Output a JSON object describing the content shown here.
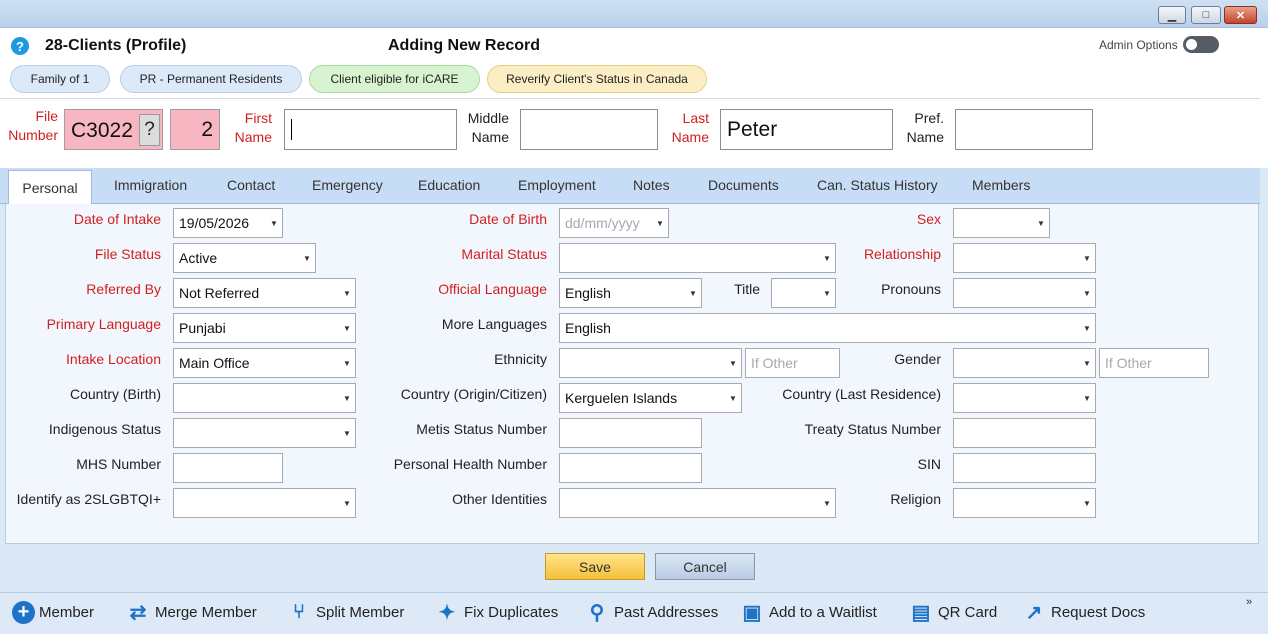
{
  "window": {
    "min_label": "▁",
    "max_label": "□",
    "close_label": "✕"
  },
  "header": {
    "title": "28-Clients (Profile)",
    "mode": "Adding New Record",
    "admin_options": "Admin Options",
    "help_glyph": "?"
  },
  "chips": [
    {
      "label": "Family of 1",
      "color": "#dce9f8"
    },
    {
      "label": "PR - Permanent Residents",
      "color": "#dce9f8"
    },
    {
      "label": "Client eligible for iCARE",
      "color": "#d8f3d0"
    },
    {
      "label": "Reverify Client's Status in Canada",
      "color": "#fbeec4"
    }
  ],
  "record": {
    "file_number_label1": "File",
    "file_number_label2": "Number",
    "file_number": "C3022",
    "file_help": "?",
    "member_no": "2",
    "first_name_label1": "First",
    "first_name_label2": "Name",
    "first_name": "",
    "middle_name_label1": "Middle",
    "middle_name_label2": "Name",
    "middle_name": "",
    "last_name_label1": "Last",
    "last_name_label2": "Name",
    "last_name": "Peter",
    "pref_name_label1": "Pref.",
    "pref_name_label2": "Name",
    "pref_name": ""
  },
  "tabs": [
    "Personal",
    "Immigration",
    "Contact",
    "Emergency",
    "Education",
    "Employment",
    "Notes",
    "Documents",
    "Can. Status History",
    "Members"
  ],
  "personal": {
    "date_of_intake_label": "Date of Intake",
    "date_of_intake": "19/05/2026",
    "date_of_birth_label": "Date of Birth",
    "date_of_birth_placeholder": "dd/mm/yyyy",
    "sex_label": "Sex",
    "sex": "",
    "file_status_label": "File Status",
    "file_status": "Active",
    "marital_status_label": "Marital Status",
    "marital_status": "",
    "relationship_label": "Relationship",
    "relationship": "",
    "referred_by_label": "Referred By",
    "referred_by": "Not Referred",
    "official_language_label": "Official Language",
    "official_language": "English",
    "title_label": "Title",
    "title": "",
    "pronouns_label": "Pronouns",
    "pronouns": "",
    "primary_language_label": "Primary Language",
    "primary_language": "Punjabi",
    "more_languages_label": "More Languages",
    "more_languages": "English",
    "intake_location_label": "Intake Location",
    "intake_location": "Main Office",
    "ethnicity_label": "Ethnicity",
    "ethnicity": "",
    "ethnicity_other_placeholder": "If Other",
    "gender_label": "Gender",
    "gender": "",
    "gender_other_placeholder": "If Other",
    "country_birth_label": "Country (Birth)",
    "country_birth": "",
    "country_origin_label": "Country (Origin/Citizen)",
    "country_origin": "Kerguelen Islands",
    "country_last_label": "Country (Last Residence)",
    "country_last": "",
    "indigenous_label": "Indigenous Status",
    "indigenous": "",
    "metis_label": "Metis Status Number",
    "metis": "",
    "treaty_label": "Treaty Status Number",
    "treaty": "",
    "mhs_label": "MHS Number",
    "mhs": "",
    "phn_label": "Personal Health Number",
    "phn": "",
    "sin_label": "SIN",
    "sin": "",
    "identify_label": "Identify as 2SLGBTQI+",
    "identify": "",
    "other_identities_label": "Other Identities",
    "other_identities": "",
    "religion_label": "Religion",
    "religion": ""
  },
  "actions": {
    "save": "Save",
    "cancel": "Cancel"
  },
  "footer": [
    {
      "label": "Member",
      "icon": "plus-circle-icon",
      "glyph": "+"
    },
    {
      "label": "Merge Member",
      "icon": "merge-arrows-icon",
      "glyph": "⇄"
    },
    {
      "label": "Split Member",
      "icon": "split-arrows-icon",
      "glyph": "⑂"
    },
    {
      "label": "Fix Duplicates",
      "icon": "sparkle-stars-icon",
      "glyph": "✦"
    },
    {
      "label": "Past Addresses",
      "icon": "map-pin-person-icon",
      "glyph": "⚲"
    },
    {
      "label": "Add to a Waitlist",
      "icon": "waitlist-add-icon",
      "glyph": "▣"
    },
    {
      "label": "QR Card",
      "icon": "id-badge-icon",
      "glyph": "▤"
    },
    {
      "label": "Request Docs",
      "icon": "external-link-icon",
      "glyph": "↗"
    }
  ],
  "more_glyph": "»"
}
